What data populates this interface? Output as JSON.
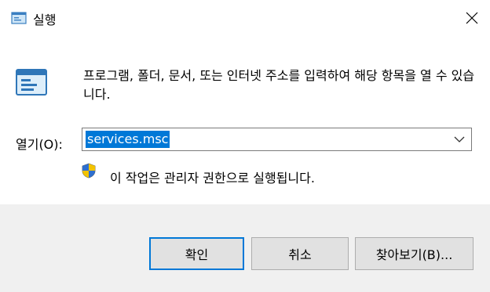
{
  "window": {
    "title": "실행",
    "icon": "run-icon",
    "close_icon": "close-icon"
  },
  "content": {
    "description": "프로그램, 폴더, 문서, 또는 인터넷 주소를 입력하여 해당 항목을 열 수 있습니다.",
    "open_label": "열기(O):",
    "open_value": "services.msc",
    "admin_note": "이 작업은 관리자 권한으로 실행됩니다."
  },
  "buttons": {
    "ok": "확인",
    "cancel": "취소",
    "browse": "찾아보기(B)..."
  },
  "colors": {
    "accent": "#0078d7",
    "footer_bg": "#f0f0f0",
    "button_bg": "#e1e1e1"
  }
}
